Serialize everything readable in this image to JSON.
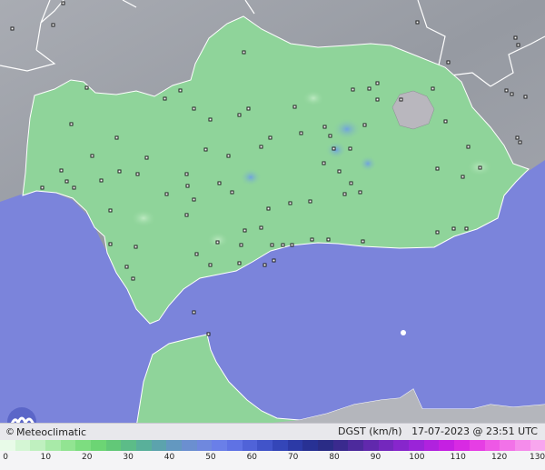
{
  "caption": {
    "brand": "Meteoclimatic",
    "copyright_symbol": "©",
    "product": "DGST (km/h)",
    "datetime": "17-07-2023 @ 23:51 UTC"
  },
  "scale": {
    "unit": "km/h",
    "ticks": [
      "0",
      "10",
      "20",
      "30",
      "40",
      "50",
      "60",
      "70",
      "80",
      "90",
      "100",
      "110",
      "120",
      "130"
    ],
    "colors": [
      "#e8fbe8",
      "#d4f6d4",
      "#bff0bf",
      "#a8eaa8",
      "#92e492",
      "#7ddd80",
      "#6cd574",
      "#62c878",
      "#5cbc88",
      "#59b09a",
      "#5ca3ad",
      "#6398c0",
      "#6b8fd0",
      "#6f88de",
      "#6a7fe8",
      "#5f72e4",
      "#5063d8",
      "#4154c9",
      "#3446b8",
      "#2c3aa6",
      "#283194",
      "#2a2c86",
      "#3a2a8e",
      "#4d2a9c",
      "#6129ad",
      "#7428bd",
      "#8726cc",
      "#9a24d8",
      "#b022de",
      "#c520e2",
      "#d82ae3",
      "#e63ee4",
      "#ee58e6",
      "#f272e8",
      "#f58ceb",
      "#f8a6ee"
    ]
  },
  "map": {
    "sea_color": "#7b84db",
    "land_outside_color": "#9a9ea6",
    "region_color": "#8fd49a",
    "region": "Andalucía"
  }
}
